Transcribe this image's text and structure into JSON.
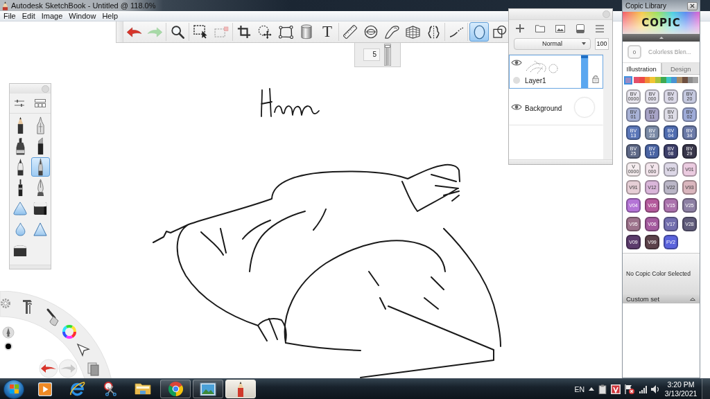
{
  "window": {
    "title": "Autodesk SketchBook - Untitled @ 118.0%"
  },
  "menu": [
    "File",
    "Edit",
    "Image",
    "Window",
    "Help"
  ],
  "toolbar": {
    "tools": [
      {
        "selected": false,
        "disabled": false
      },
      {
        "selected": false,
        "disabled": true
      },
      {
        "selected": false,
        "disabled": false
      },
      {
        "selected": false,
        "disabled": false
      },
      {
        "selected": false,
        "disabled": true
      },
      {
        "selected": false,
        "disabled": false
      },
      {
        "selected": false,
        "disabled": false
      },
      {
        "selected": false,
        "disabled": false
      },
      {
        "selected": false,
        "disabled": false
      },
      {
        "label": "T",
        "selected": false,
        "disabled": false
      },
      {
        "selected": false,
        "disabled": false
      },
      {
        "selected": false,
        "disabled": false
      },
      {
        "selected": false,
        "disabled": false
      },
      {
        "selected": false,
        "disabled": false
      },
      {
        "selected": false,
        "disabled": false
      },
      {
        "selected": false,
        "disabled": false
      },
      {
        "selected": true,
        "disabled": false
      },
      {
        "selected": false,
        "disabled": false
      }
    ]
  },
  "brush_size": {
    "value": "5",
    "level": 0.95
  },
  "layers": {
    "blend_mode": "Normal",
    "opacity": "100",
    "items": [
      {
        "kind": "paint",
        "name": "Layer1",
        "visible": true,
        "selected": true
      },
      {
        "kind": "background",
        "name": "Background",
        "visible": true,
        "selected": false
      }
    ]
  },
  "brushes": [
    {
      "selected": false
    },
    {
      "selected": false
    },
    {
      "selected": false
    },
    {
      "selected": false
    },
    {
      "selected": false
    },
    {
      "selected": true
    },
    {
      "selected": false
    },
    {
      "selected": false
    },
    {
      "selected": false
    },
    {
      "selected": false
    },
    {
      "selected": false
    },
    {
      "selected": false
    },
    {
      "selected": false
    }
  ],
  "lagoon": {
    "color": "#000000",
    "undo": {
      "disabled": false
    },
    "redo": {
      "disabled": true
    }
  },
  "copic": {
    "title": "Copic Library",
    "logo": "COPIC",
    "blender": {
      "code": "0",
      "name": "Colorless Blen..."
    },
    "tabs": [
      {
        "label": "Illustration",
        "selected": true
      },
      {
        "label": "Design",
        "selected": false
      }
    ],
    "families": [
      {
        "color": "#9a8cc4",
        "selected": true
      },
      {
        "color": "#e4506a",
        "selected": false
      },
      {
        "color": "#ee4a48",
        "selected": false
      },
      {
        "color": "#f08c34",
        "selected": false
      },
      {
        "color": "#f2c434",
        "selected": false
      },
      {
        "color": "#a6c43e",
        "selected": false
      },
      {
        "color": "#3eaa52",
        "selected": false
      },
      {
        "color": "#3ec6c8",
        "selected": false
      },
      {
        "color": "#4a94d2",
        "selected": false
      },
      {
        "color": "#a88a66",
        "selected": false
      },
      {
        "color": "#6e5040",
        "selected": false
      },
      {
        "color": "#8c8c8c",
        "selected": false
      },
      {
        "color": "#a4a4a4",
        "selected": false
      }
    ],
    "markers": [
      {
        "code": "BV 0000",
        "color": "#e9e7ef"
      },
      {
        "code": "BV 000",
        "color": "#e3e1ed"
      },
      {
        "code": "BV 00",
        "color": "#dbd9e8"
      },
      {
        "code": "BV 20",
        "color": "#c5c9e0"
      },
      {
        "code": "BV 01",
        "color": "#a8b2d6"
      },
      {
        "code": "BV 11",
        "color": "#a7a3c6"
      },
      {
        "code": "BV 31",
        "color": "#dedde7"
      },
      {
        "code": "BV 02",
        "color": "#9eabd8"
      },
      {
        "code": "BV 13",
        "color": "#5a76b8"
      },
      {
        "code": "BV 23",
        "color": "#7a8aa6"
      },
      {
        "code": "BV 04",
        "color": "#4f6cb0"
      },
      {
        "code": "BV 34",
        "color": "#6b7aa8"
      },
      {
        "code": "BV 25",
        "color": "#5d6886"
      },
      {
        "code": "BV 17",
        "color": "#4a64a4"
      },
      {
        "code": "BV 08",
        "color": "#3d3f6a"
      },
      {
        "code": "BV 29",
        "color": "#38364a"
      },
      {
        "code": "V 0000",
        "color": "#f5edef"
      },
      {
        "code": "V 000",
        "color": "#f3e5ec"
      },
      {
        "code": "V20",
        "color": "#dcd7e6"
      },
      {
        "code": "V01",
        "color": "#ebcbe0"
      },
      {
        "code": "V91",
        "color": "#e6cfd6"
      },
      {
        "code": "V12",
        "color": "#dab6da"
      },
      {
        "code": "V22",
        "color": "#bab6c7"
      },
      {
        "code": "V93",
        "color": "#dab6be"
      },
      {
        "code": "V04",
        "color": "#b474d6"
      },
      {
        "code": "V05",
        "color": "#b45a9c"
      },
      {
        "code": "V15",
        "color": "#ab72ad"
      },
      {
        "code": "V25",
        "color": "#8d80a4"
      },
      {
        "code": "V95",
        "color": "#9c728b"
      },
      {
        "code": "V06",
        "color": "#a45a9e"
      },
      {
        "code": "V17",
        "color": "#726eae"
      },
      {
        "code": "V28",
        "color": "#5f5b7a"
      },
      {
        "code": "V09",
        "color": "#5b3b6c"
      },
      {
        "code": "V99",
        "color": "#5c424a"
      },
      {
        "code": "FV2",
        "color": "#5a63dc"
      }
    ],
    "status": "No Copic Color Selected",
    "custom_set": "Custom set"
  },
  "taskbar": {
    "apps": [
      {
        "running": false,
        "selected": false
      },
      {
        "running": false,
        "selected": false
      },
      {
        "running": false,
        "selected": false
      },
      {
        "running": false,
        "selected": false
      },
      {
        "running": true,
        "selected": false
      },
      {
        "running": true,
        "selected": false
      },
      {
        "running": true,
        "selected": true
      }
    ],
    "language": "EN",
    "time": "3:20 PM",
    "date": "3/13/2021"
  }
}
